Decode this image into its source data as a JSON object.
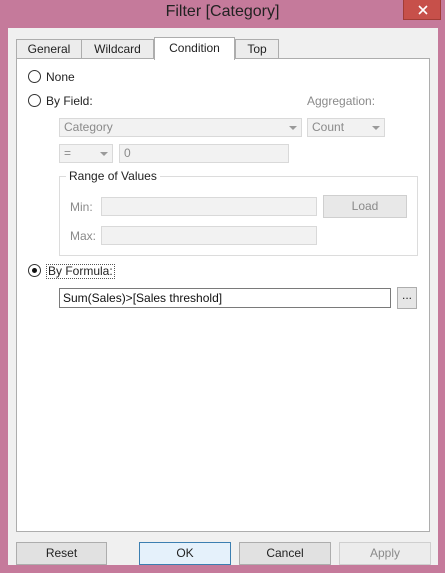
{
  "window": {
    "title": "Filter [Category]"
  },
  "tabs": [
    {
      "label": "General",
      "active": false
    },
    {
      "label": "Wildcard",
      "active": false
    },
    {
      "label": "Condition",
      "active": true
    },
    {
      "label": "Top",
      "active": false
    }
  ],
  "condition": {
    "none_label": "None",
    "by_field_label": "By Field:",
    "aggregation_label": "Aggregation:",
    "field_value": "Category",
    "aggregation_value": "Count",
    "operator_value": "=",
    "operator_amount": "0",
    "range": {
      "title": "Range of Values",
      "min_label": "Min:",
      "max_label": "Max:",
      "load_label": "Load"
    },
    "by_formula_label": "By Formula:",
    "formula_value": "Sum(Sales)>[Sales threshold]",
    "formula_button_label": "...",
    "selected": "by_formula"
  },
  "footer": {
    "reset_label": "Reset",
    "ok_label": "OK",
    "cancel_label": "Cancel",
    "apply_label": "Apply"
  }
}
